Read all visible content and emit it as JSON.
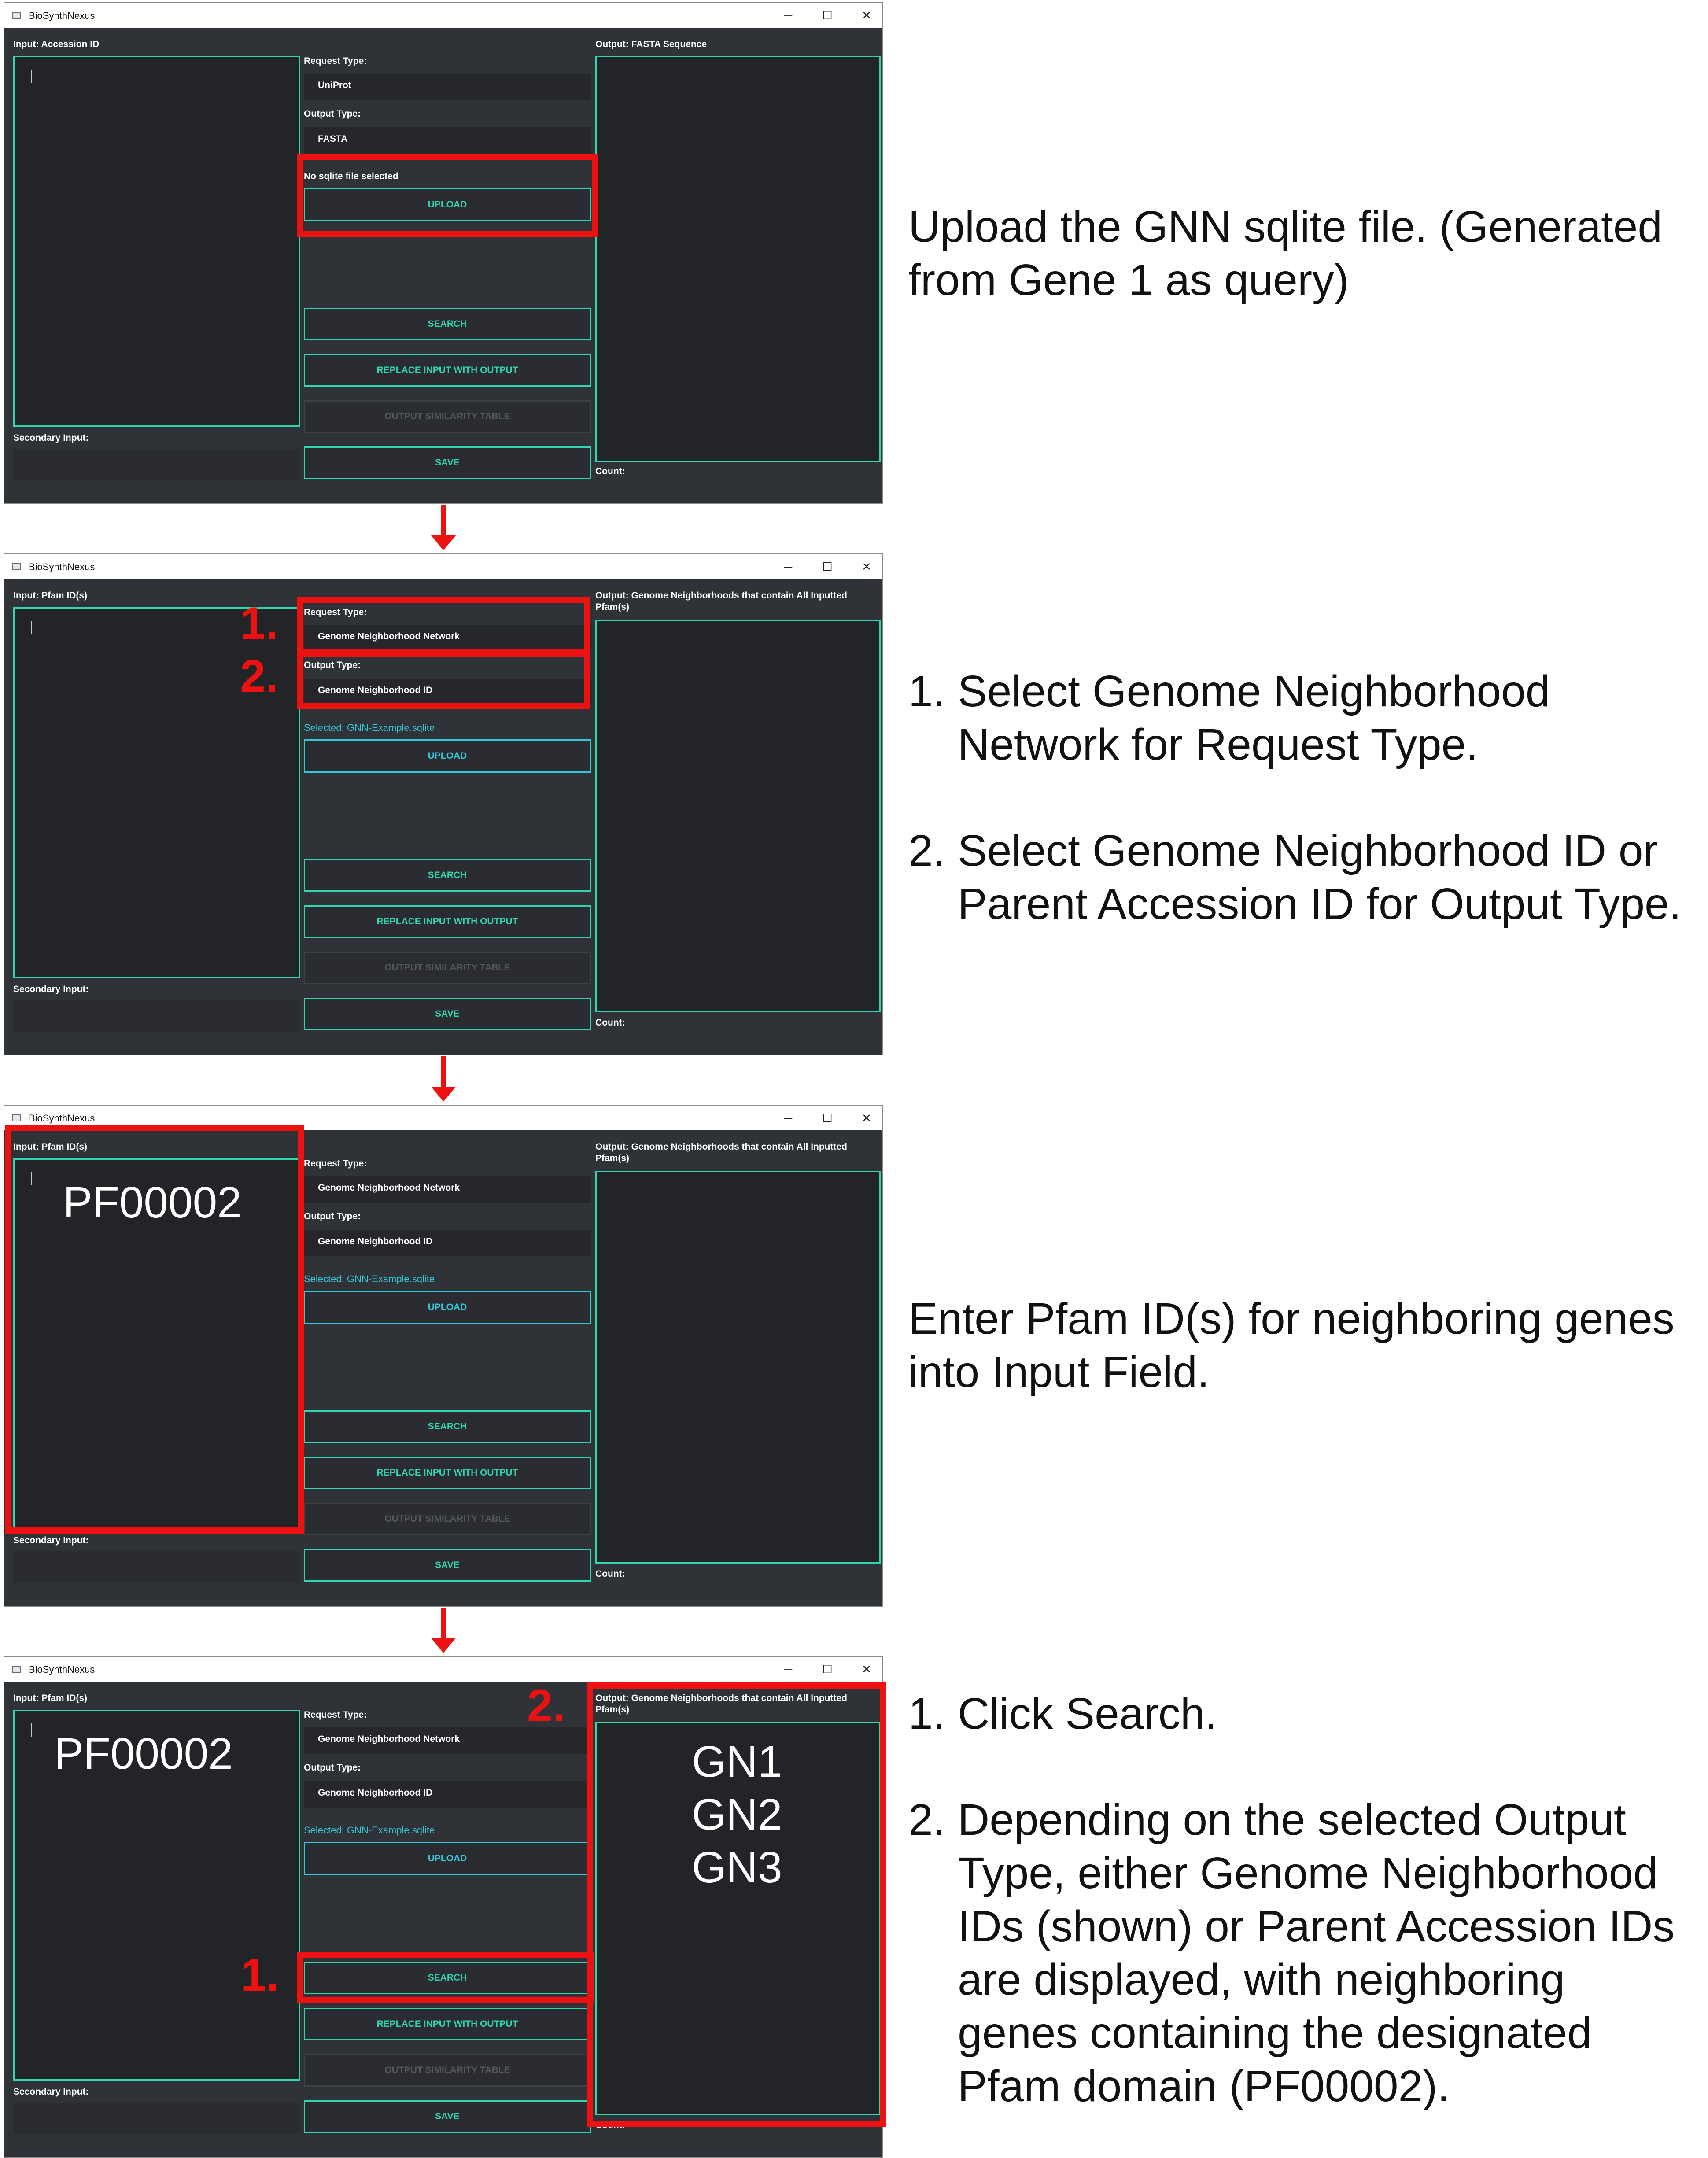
{
  "window": {
    "title": "BioSynthNexus",
    "minimize": "─",
    "maximize": "☐",
    "close": "✕"
  },
  "common": {
    "request_type_label": "Request Type:",
    "output_type_label": "Output Type:",
    "secondary_input_label": "Secondary Input:",
    "count_label": "Count:",
    "upload_button": "UPLOAD",
    "search_button": "SEARCH",
    "replace_button": "REPLACE INPUT WITH OUTPUT",
    "similarity_button": "OUTPUT SIMILARITY TABLE",
    "save_button": "SAVE"
  },
  "steps": [
    {
      "input_label": "Input: Accession ID",
      "request_type": "UniProt",
      "output_type": "FASTA",
      "file_status": "No sqlite file selected",
      "output_label_line1": "Output: FASTA Sequence",
      "output_label_line2": "",
      "description": "Upload the GNN sqlite file. (Generated from Gene 1 as query)"
    },
    {
      "input_label": "Input: Pfam ID(s)",
      "request_type": "Genome Neighborhood Network",
      "output_type": "Genome Neighborhood ID",
      "file_status": "Selected: GNN-Example.sqlite",
      "output_label_line1": "Output: Genome Neighborhoods that contain All Inputted",
      "output_label_line2": "Pfam(s)",
      "marker1": "1.",
      "marker2": "2.",
      "desc_item1_num": "1.",
      "desc_item1": "Select Genome Neighborhood Network for Request Type.",
      "desc_item2_num": "2.",
      "desc_item2": "Select Genome Neighborhood ID or Parent Accession ID for Output Type."
    },
    {
      "input_label": "Input: Pfam ID(s)",
      "request_type": "Genome Neighborhood Network",
      "output_type": "Genome Neighborhood ID",
      "file_status": "Selected: GNN-Example.sqlite",
      "output_label_line1": "Output: Genome Neighborhoods that contain All Inputted",
      "output_label_line2": "Pfam(s)",
      "input_value": "PF00002",
      "description": "Enter Pfam ID(s) for neighboring genes into Input Field."
    },
    {
      "input_label": "Input: Pfam ID(s)",
      "request_type": "Genome Neighborhood Network",
      "output_type": "Genome Neighborhood ID",
      "file_status": "Selected: GNN-Example.sqlite",
      "output_label_line1": "Output: Genome Neighborhoods that contain All Inputted",
      "output_label_line2": "Pfam(s)",
      "input_value": "PF00002",
      "output_values": [
        "GN1",
        "GN2",
        "GN3"
      ],
      "marker1": "1.",
      "marker2": "2.",
      "desc_item1_num": "1.",
      "desc_item1": "Click Search.",
      "desc_item2_num": "2.",
      "desc_item2": "Depending on the selected Output Type, either Genome Neighborhood IDs (shown) or Parent Accession IDs are displayed, with neighboring genes containing the designated Pfam domain (PF00002)."
    }
  ]
}
